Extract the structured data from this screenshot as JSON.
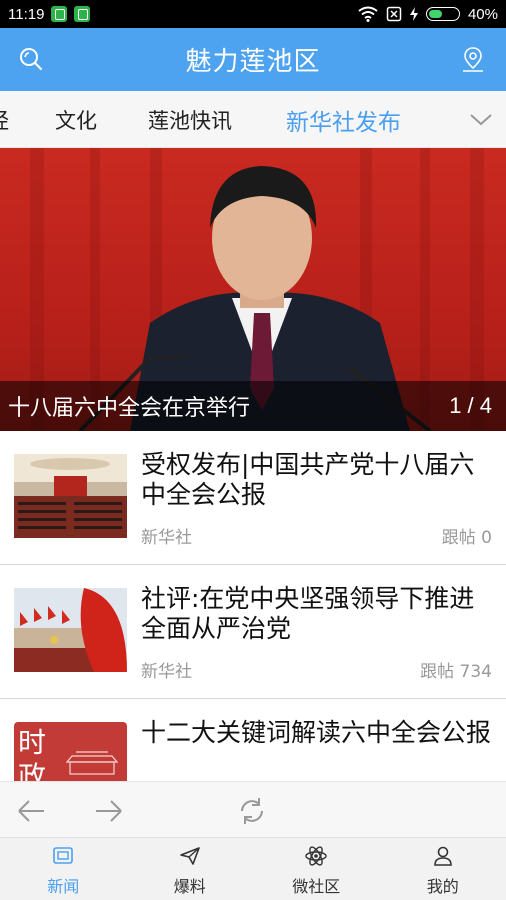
{
  "status_bar": {
    "time": "11:19",
    "battery": "40%"
  },
  "header": {
    "title": "魅力莲池区"
  },
  "tabs": [
    {
      "label": "经"
    },
    {
      "label": "文化"
    },
    {
      "label": "莲池快讯"
    },
    {
      "label": "新华社发布",
      "active": true
    }
  ],
  "banner": {
    "caption": "十八届六中全会在京举行",
    "pager": "1 / 4"
  },
  "news": [
    {
      "headline": "受权发布|中国共产党十八届六中全会公报",
      "source": "新华社",
      "comments": "跟帖 0"
    },
    {
      "headline": "社评:在党中央坚强领导下推进全面从严治党",
      "source": "新华社",
      "comments": "跟帖 734"
    },
    {
      "headline": "十二大关键词解读六中全会公报",
      "thumb_text": "时政"
    }
  ],
  "bottom_tabs": [
    {
      "label": "新闻",
      "icon": "news-icon",
      "active": true
    },
    {
      "label": "爆料",
      "icon": "send-icon"
    },
    {
      "label": "微社区",
      "icon": "atom-icon"
    },
    {
      "label": "我的",
      "icon": "user-icon"
    }
  ],
  "colors": {
    "accent": "#4da3ef",
    "active_text": "#4a9ff0"
  }
}
